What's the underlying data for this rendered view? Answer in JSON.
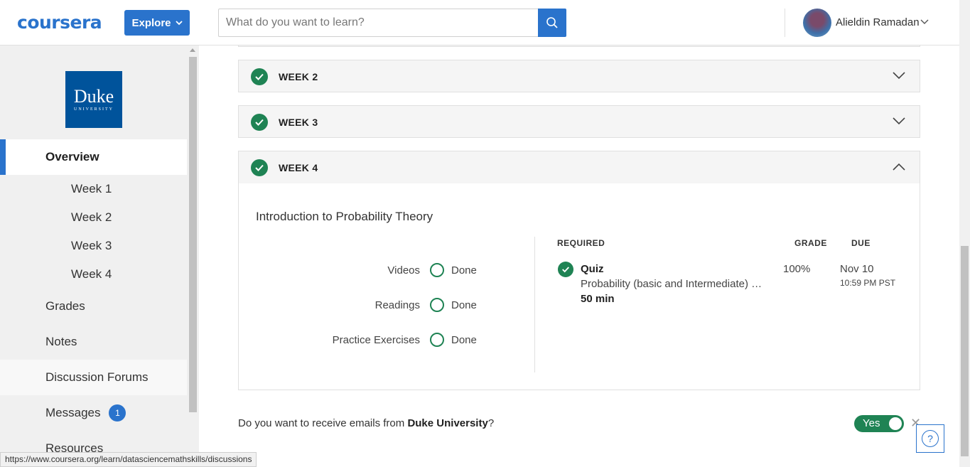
{
  "header": {
    "logo": "coursera",
    "explore_label": "Explore",
    "search_placeholder": "What do you want to learn?",
    "user_name": "Alieldin Ramadan"
  },
  "sidebar": {
    "university_logo_line1": "Duke",
    "university_logo_line2": "UNIVERSITY",
    "items": [
      {
        "label": "Overview",
        "active": true
      },
      {
        "label": "Week 1"
      },
      {
        "label": "Week 2"
      },
      {
        "label": "Week 3"
      },
      {
        "label": "Week 4"
      },
      {
        "label": "Grades"
      },
      {
        "label": "Notes"
      },
      {
        "label": "Discussion Forums"
      },
      {
        "label": "Messages",
        "badge": "1"
      },
      {
        "label": "Resources"
      }
    ]
  },
  "weeks": [
    {
      "title": "WEEK 2",
      "completed": true
    },
    {
      "title": "WEEK 3",
      "completed": true
    },
    {
      "title": "WEEK 4",
      "completed": true,
      "expanded": true
    }
  ],
  "week4": {
    "module_title": "Introduction to Probability Theory",
    "progress": [
      {
        "label": "Videos",
        "status": "Done"
      },
      {
        "label": "Readings",
        "status": "Done"
      },
      {
        "label": "Practice Exercises",
        "status": "Done"
      }
    ],
    "columns": {
      "required": "REQUIRED",
      "grade": "GRADE",
      "due": "DUE"
    },
    "quiz": {
      "type": "Quiz",
      "title": "Probability (basic and Intermediate) Graded Quiz",
      "duration": "50 min",
      "grade": "100%",
      "due_date": "Nov 10",
      "due_time": "10:59 PM PST"
    }
  },
  "email_prompt": {
    "text_before": "Do you want to receive emails from ",
    "university": "Duke University",
    "text_after": "?",
    "toggle_label": "Yes",
    "close": "✕"
  },
  "help_label": "?",
  "status_bar_url": "https://www.coursera.org/learn/datasciencemathskills/discussions",
  "colors": {
    "brand_blue": "#2a73cc",
    "success_green": "#1f8354"
  }
}
